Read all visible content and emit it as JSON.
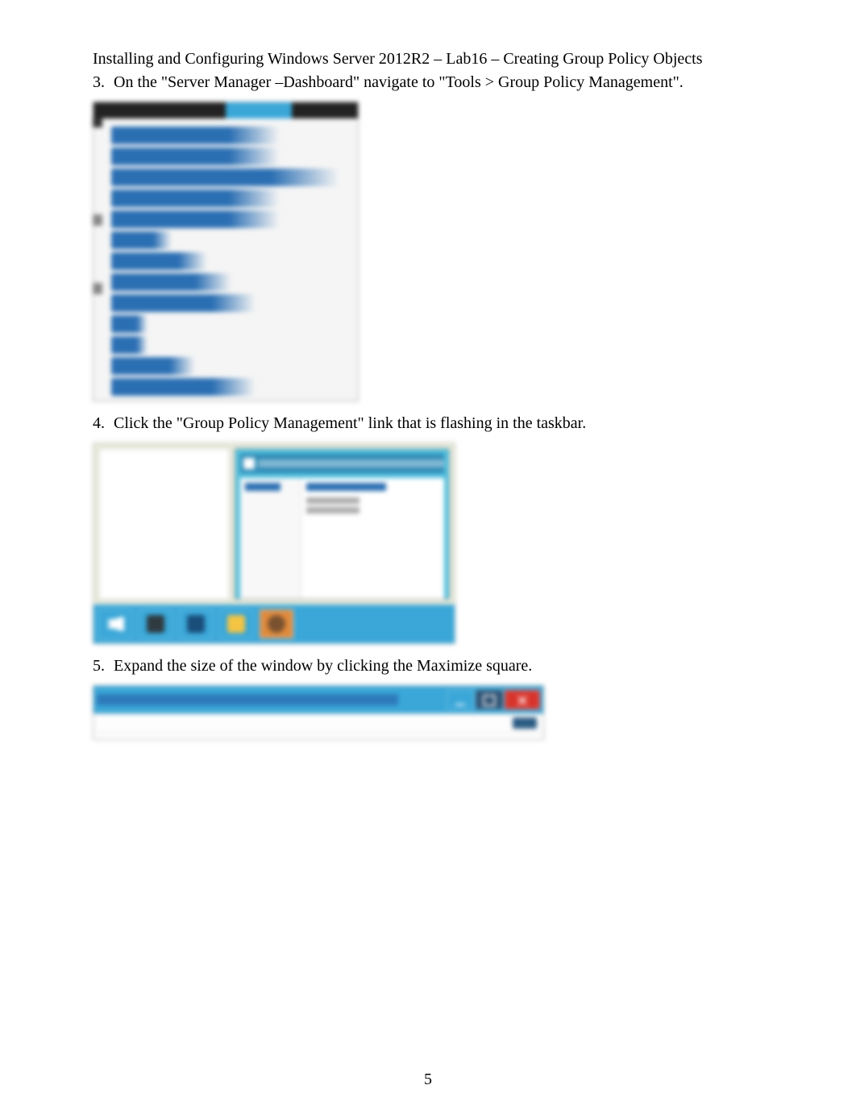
{
  "header": {
    "title": "Installing and Configuring Windows Server 2012R2 – Lab16 – Creating Group Policy Objects"
  },
  "steps": {
    "s3": {
      "num": "3.",
      "text": "On the \"Server Manager –Dashboard\" navigate to \"Tools > Group Policy Management\"."
    },
    "s4": {
      "num": "4.",
      "text": "Click the \"Group Policy Management\" link that is flashing in the taskbar."
    },
    "s5": {
      "num": "5.",
      "text": "Expand the size of the window by clicking the Maximize square."
    }
  },
  "screenshot1": {
    "topbar_active": "Tools",
    "menu_items": [
      "Active Directory Administrative Center",
      "Active Directory Domains and Trusts",
      "Active Directory Module for Windows PowerShell",
      "Active Directory Sites and Services",
      "Active Directory Users and Computers",
      "ADSI Edit",
      "Component Services",
      "Computer Management",
      "Defragment and Optimize Drives",
      "DHCP",
      "DNS",
      "Event Viewer",
      "Group Policy Management"
    ]
  },
  "screenshot2": {
    "window_title": "Group Policy Management",
    "tree_root": "Forest: adatum.com",
    "taskbar_items": [
      "start",
      "server-manager",
      "powershell",
      "explorer",
      "group-policy-management"
    ]
  },
  "screenshot3": {
    "window_title": "Group Policy Management",
    "buttons": [
      "minimize",
      "maximize",
      "close"
    ]
  },
  "page_number": "5"
}
